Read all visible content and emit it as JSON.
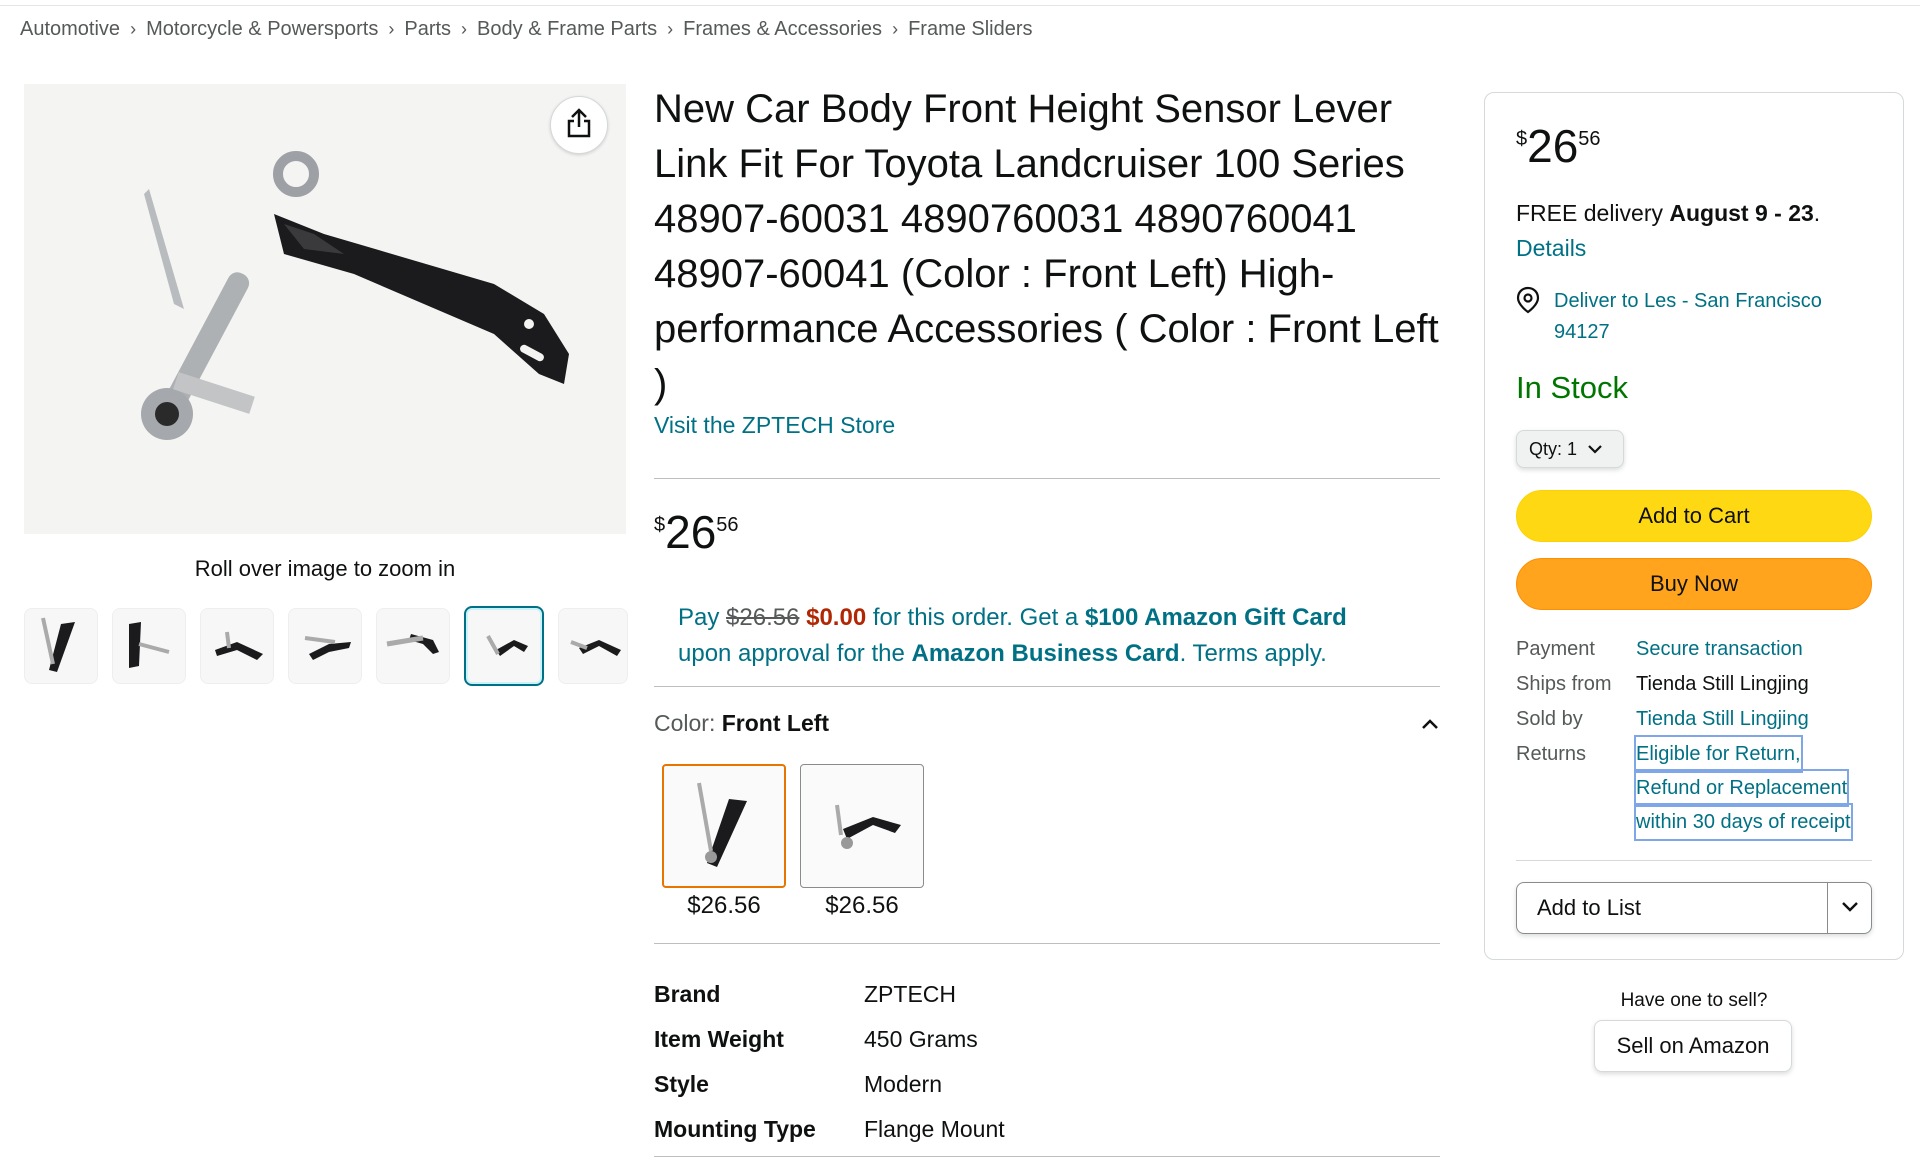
{
  "breadcrumb": [
    "Automotive",
    "Motorcycle & Powersports",
    "Parts",
    "Body & Frame Parts",
    "Frames & Accessories",
    "Frame Sliders"
  ],
  "breadcrumb_separator": "›",
  "gallery": {
    "roll_text": "Roll over image to zoom in",
    "share_icon": "share-icon",
    "thumbnail_count": 7,
    "selected_thumbnail": 6
  },
  "product": {
    "title": "New Car Body Front Height Sensor Lever Link Fit For Toyota Landcruiser 100 Series 48907-60031 4890760031 4890760041 48907-60041 (Color : Front Left) High-performance Accessories ( Color : Front Left )",
    "store_link": "Visit the ZPTECH Store",
    "price": {
      "symbol": "$",
      "whole": "26",
      "fraction": "56"
    }
  },
  "promo": {
    "pay": "Pay",
    "old_price": "$26.56",
    "new_price": "$0.00",
    "text1": "for this order. Get a",
    "gift_card": "$100 Amazon Gift Card",
    "text2": "upon approval for the",
    "card_name": "Amazon Business Card",
    "text3": ". Terms apply."
  },
  "color": {
    "label": "Color:",
    "value": "Front Left",
    "options": [
      {
        "price": "$26.56",
        "selected": true
      },
      {
        "price": "$26.56",
        "selected": false
      }
    ]
  },
  "specs": [
    {
      "key": "Brand",
      "value": "ZPTECH"
    },
    {
      "key": "Item Weight",
      "value": "450 Grams"
    },
    {
      "key": "Style",
      "value": "Modern"
    },
    {
      "key": "Mounting Type",
      "value": "Flange Mount"
    }
  ],
  "buybox": {
    "price": {
      "symbol": "$",
      "whole": "26",
      "fraction": "56"
    },
    "delivery_prefix": "FREE delivery",
    "delivery_dates": "August 9 - 23",
    "delivery_suffix": ".",
    "details_link": "Details",
    "deliver_to_line1": "Deliver to Les - San Francisco",
    "deliver_to_line2": "94127",
    "stock": "In Stock",
    "qty_label": "Qty:",
    "qty_value": "1",
    "add_to_cart": "Add to Cart",
    "buy_now": "Buy Now",
    "info": {
      "payment_key": "Payment",
      "payment_val": "Secure transaction",
      "ships_key": "Ships from",
      "ships_val": "Tienda Still Lingjing",
      "sold_key": "Sold by",
      "sold_val": "Tienda Still Lingjing",
      "returns_key": "Returns",
      "returns_line1": "Eligible for Return,",
      "returns_line2": "Refund or Replacement",
      "returns_line3": "within 30 days of receipt"
    },
    "add_to_list": "Add to List",
    "sell_question": "Have one to sell?",
    "sell_button": "Sell on Amazon"
  },
  "colors": {
    "link": "#007185",
    "in_stock": "#007600",
    "deal_red": "#b12704",
    "cart_yellow": "#ffd814",
    "buy_orange": "#ffa41c",
    "selected_swatch": "#e77600"
  }
}
